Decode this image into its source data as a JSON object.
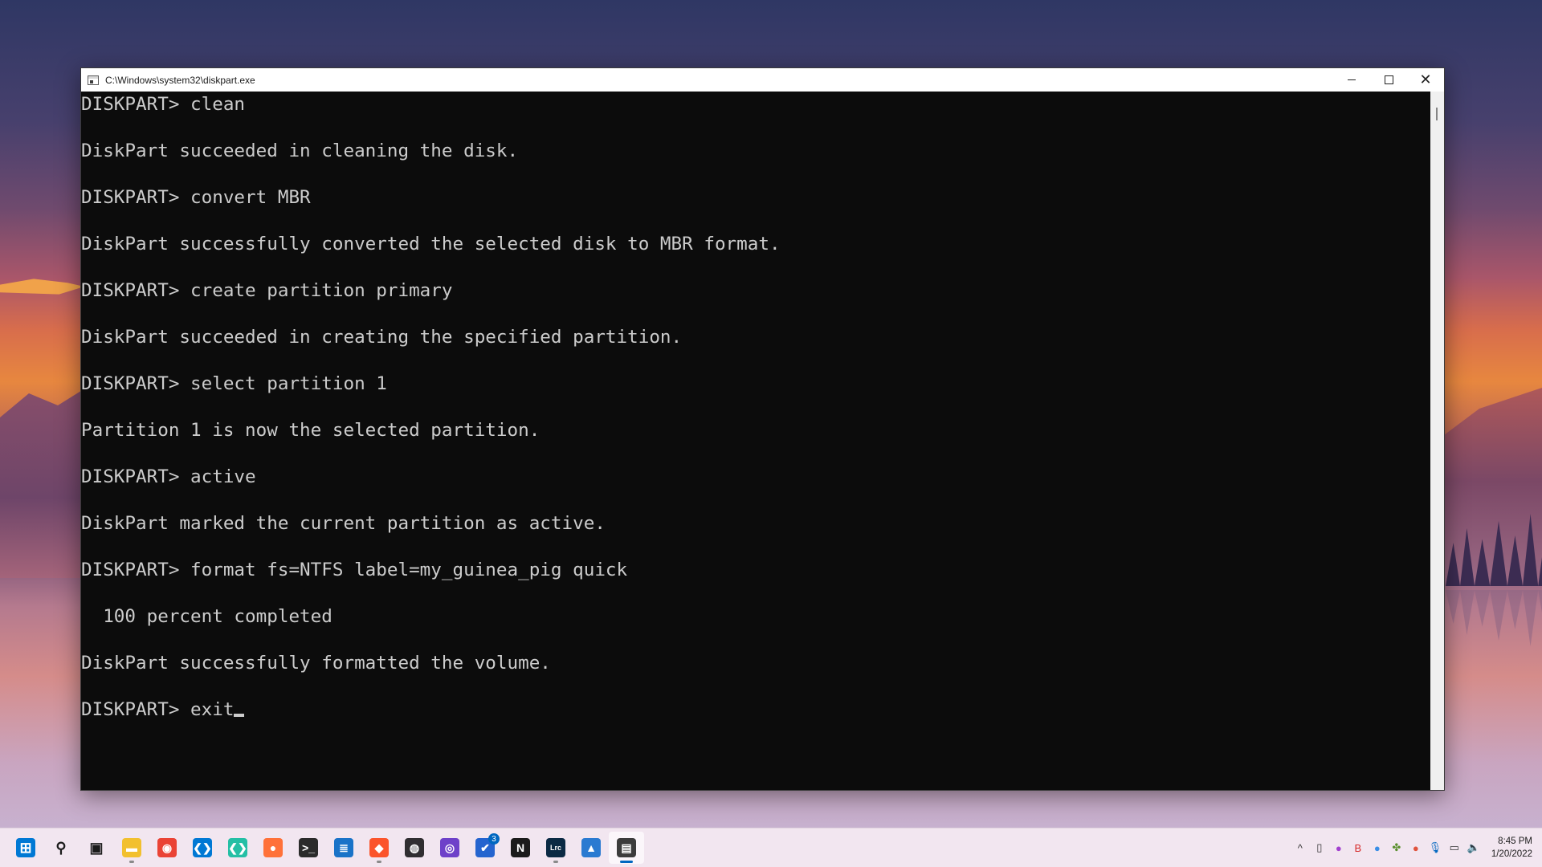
{
  "window": {
    "title": "C:\\Windows\\system32\\diskpart.exe",
    "controls": {
      "minimize": "",
      "maximize": "",
      "close": "✕"
    }
  },
  "console": {
    "lines": [
      "DISKPART> clean",
      "",
      "DiskPart succeeded in cleaning the disk.",
      "",
      "DISKPART> convert MBR",
      "",
      "DiskPart successfully converted the selected disk to MBR format.",
      "",
      "DISKPART> create partition primary",
      "",
      "DiskPart succeeded in creating the specified partition.",
      "",
      "DISKPART> select partition 1",
      "",
      "Partition 1 is now the selected partition.",
      "",
      "DISKPART> active",
      "",
      "DiskPart marked the current partition as active.",
      "",
      "DISKPART> format fs=NTFS label=my_guinea_pig quick",
      "",
      "  100 percent completed",
      "",
      "DiskPart successfully formatted the volume.",
      "",
      "DISKPART> exit"
    ]
  },
  "taskbar": {
    "apps": [
      {
        "name": "start-icon",
        "color": "#0078d4",
        "glyph": "⊞"
      },
      {
        "name": "search-icon",
        "color": "#1b1b1b",
        "glyph": "⚲"
      },
      {
        "name": "task-view-icon",
        "color": "#1b1b1b",
        "glyph": "▣"
      },
      {
        "name": "file-explorer-icon",
        "color": "#f2c02e",
        "glyph": "▬",
        "running": true
      },
      {
        "name": "chrome-icon",
        "color": "#ea4335",
        "glyph": "◉"
      },
      {
        "name": "vscode-icon",
        "color": "#0078d4",
        "glyph": "❮❯"
      },
      {
        "name": "vscode-insiders-icon",
        "color": "#24bfa5",
        "glyph": "❮❯"
      },
      {
        "name": "firefox-icon",
        "color": "#ff7139",
        "glyph": "●"
      },
      {
        "name": "terminal-icon",
        "color": "#2b2b2b",
        "glyph": ">_"
      },
      {
        "name": "notepad-icon",
        "color": "#1a73c8",
        "glyph": "≣"
      },
      {
        "name": "brave-icon",
        "color": "#fb542b",
        "glyph": "◆",
        "running": true
      },
      {
        "name": "obs-icon",
        "color": "#302e31",
        "glyph": "◍"
      },
      {
        "name": "github-desktop-icon",
        "color": "#6e40c9",
        "glyph": "◎"
      },
      {
        "name": "todo-icon",
        "color": "#2564cf",
        "glyph": "✔",
        "badge": "3"
      },
      {
        "name": "notion-icon",
        "color": "#1b1b1b",
        "glyph": "N"
      },
      {
        "name": "lightroom-icon",
        "color": "#0b2a44",
        "glyph": "Lrc",
        "running": true
      },
      {
        "name": "photos-icon",
        "color": "#2a7ad1",
        "glyph": "▲"
      },
      {
        "name": "command-prompt-icon",
        "color": "#3c3c3c",
        "glyph": "▤",
        "active": true
      }
    ],
    "tray": [
      {
        "name": "show-hidden-icons-icon",
        "glyph": "^",
        "color": "#333333"
      },
      {
        "name": "usb-icon",
        "glyph": "▯",
        "color": "#333333"
      },
      {
        "name": "tray-app-1-icon",
        "glyph": "●",
        "color": "#a23fcf"
      },
      {
        "name": "tray-app-2-icon",
        "glyph": "B",
        "color": "#d62b2b"
      },
      {
        "name": "tray-app-3-icon",
        "glyph": "●",
        "color": "#3a8ee6"
      },
      {
        "name": "tray-app-4-icon",
        "glyph": "✤",
        "color": "#5a8f2e"
      },
      {
        "name": "tray-app-5-icon",
        "glyph": "●",
        "color": "#e0533d"
      },
      {
        "name": "microphone-icon",
        "glyph": "🎙",
        "color": "#0067c0"
      },
      {
        "name": "network-icon",
        "glyph": "▭",
        "color": "#333333"
      },
      {
        "name": "volume-icon",
        "glyph": "🔈",
        "color": "#333333"
      }
    ],
    "clock": {
      "time": "8:45 PM",
      "date": "1/20/2022"
    }
  }
}
